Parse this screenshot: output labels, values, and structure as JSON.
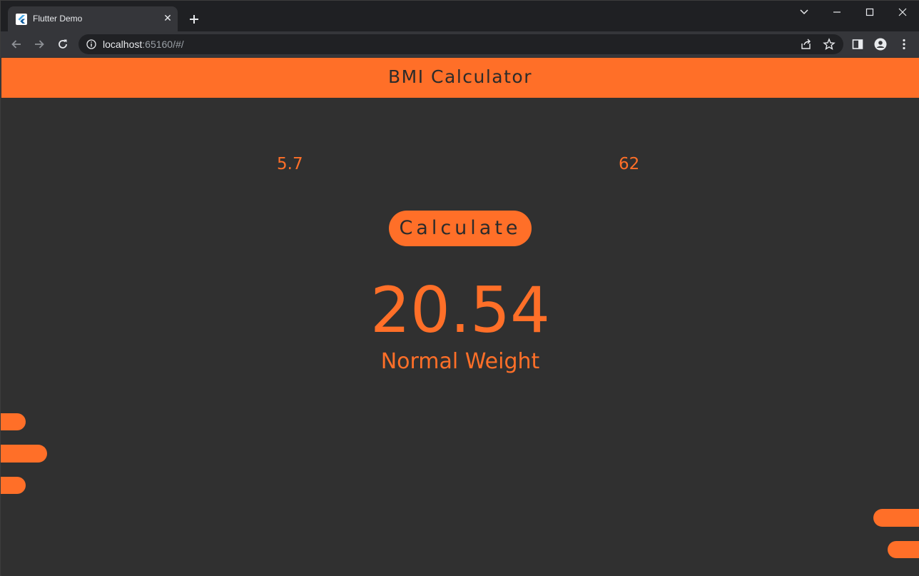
{
  "browser": {
    "tab_title": "Flutter Demo",
    "url_host": "localhost",
    "url_rest": ":65160/#/"
  },
  "app": {
    "title": "BMI Calculator",
    "height_value": "5.7",
    "weight_value": "62",
    "calculate_label": "Calculate",
    "bmi_result": "20.54",
    "bmi_category": "Normal Weight"
  },
  "colors": {
    "accent": "#ff6f28",
    "background": "#303030",
    "appbar_text": "#2b2b2b"
  }
}
